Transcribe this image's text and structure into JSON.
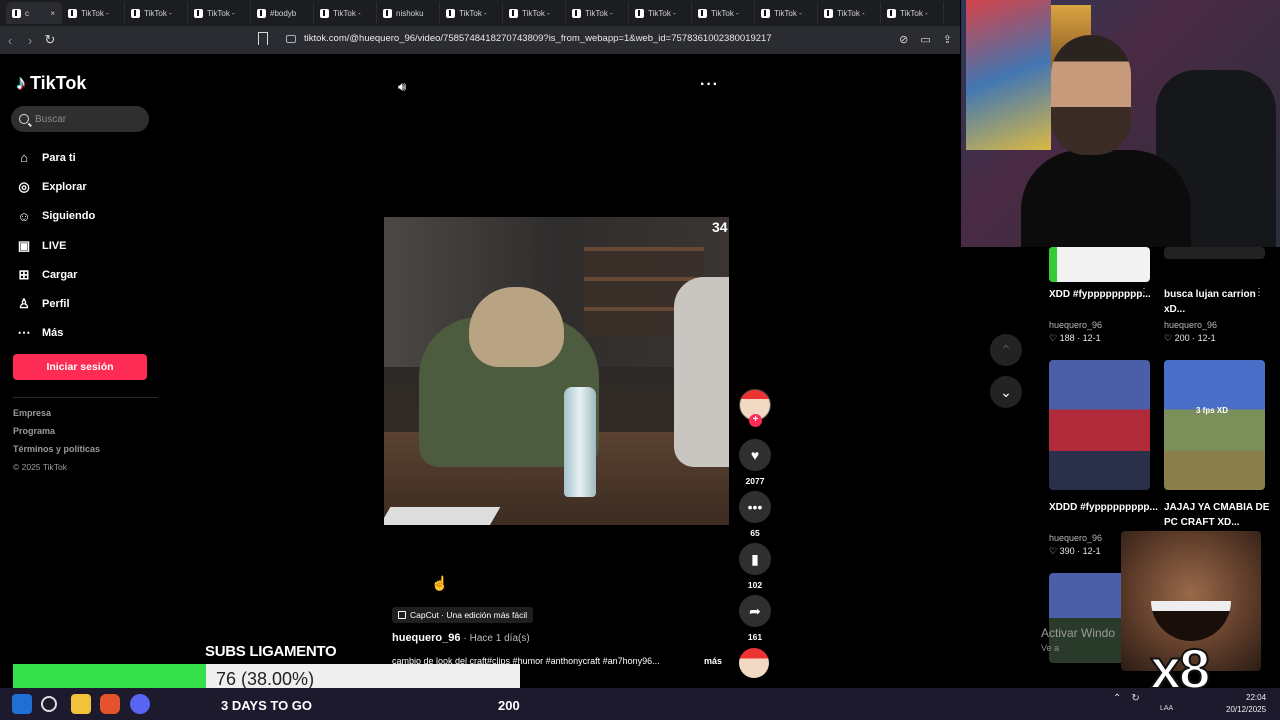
{
  "browser": {
    "tabs": [
      {
        "label": "c",
        "active": true
      },
      {
        "label": "TikTok -"
      },
      {
        "label": "TikTok -"
      },
      {
        "label": "TikTok -"
      },
      {
        "label": "#bodyb"
      },
      {
        "label": "TikTok -"
      },
      {
        "label": "nishoku"
      },
      {
        "label": "TikTok -"
      },
      {
        "label": "TikTok -"
      },
      {
        "label": "TikTok -"
      },
      {
        "label": "TikTok -"
      },
      {
        "label": "TikTok -"
      },
      {
        "label": "TikTok -"
      },
      {
        "label": "TikTok -"
      },
      {
        "label": "TikTok -"
      }
    ],
    "url": "tiktok.com/@huequero_96/video/7585748418270743809?is_from_webapp=1&web_id=7578361002380019217"
  },
  "sidebar": {
    "logo": "TikTok",
    "search_placeholder": "Buscar",
    "items": [
      {
        "label": "Para ti",
        "icon": "home-icon",
        "glyph": "⌂"
      },
      {
        "label": "Explorar",
        "icon": "compass-icon",
        "glyph": "◎"
      },
      {
        "label": "Siguiendo",
        "icon": "following-icon",
        "glyph": "☺"
      },
      {
        "label": "LIVE",
        "icon": "live-icon",
        "glyph": "▣"
      },
      {
        "label": "Cargar",
        "icon": "upload-icon",
        "glyph": "⊞"
      },
      {
        "label": "Perfil",
        "icon": "profile-icon",
        "glyph": "♙"
      },
      {
        "label": "Más",
        "icon": "more-icon",
        "glyph": "⋯"
      }
    ],
    "login_label": "Iniciar sesión",
    "footer": [
      "Empresa",
      "Programa",
      "Términos y políticas",
      "© 2025 TikTok"
    ]
  },
  "video": {
    "counter": "34",
    "likes": "2077",
    "comments": "65",
    "saves": "102",
    "shares": "161",
    "capcut_label": "CapCut · Una edición más fácil",
    "author": "huequero_96",
    "time": "· Hace 1 día(s)",
    "caption": "cambio de look del craft#clips #humor #anthonycraft #an7hony96...",
    "more_label": "más"
  },
  "recommendations": [
    {
      "title": "XDD #fyppppppppp...",
      "user": "huequero_96",
      "likes": "188",
      "date": "12-1"
    },
    {
      "title": "busca lujan carrion xD...",
      "user": "huequero_96",
      "likes": "200",
      "date": "12-1"
    },
    {
      "title": "XDDD #fyppppppppp...",
      "user": "huequero_96",
      "likes": "390",
      "date": "12-1"
    },
    {
      "title": "JAJAJ YA CMABIA DE PC CRAFT XD...",
      "user": "",
      "likes": "",
      "date": ""
    }
  ],
  "thumb_badge": "3 fps XD",
  "windows_watermark": {
    "line1": "Activar Windo",
    "line2": "Ve a"
  },
  "overlay": {
    "meme_label": "x8",
    "subs_title": "SUBS LIGAMENTO",
    "subs_value": "76 (38.00%)",
    "subs_progress": 0.38,
    "days_label": "3 DAYS TO GO",
    "goal": "200"
  },
  "taskbar": {
    "lang": "LAA",
    "time": "22:04",
    "date": "20/12/2025"
  },
  "colors": {
    "accent": "#fe2c55",
    "progress": "#36e04a",
    "taskbar": "#1d1a2e"
  }
}
